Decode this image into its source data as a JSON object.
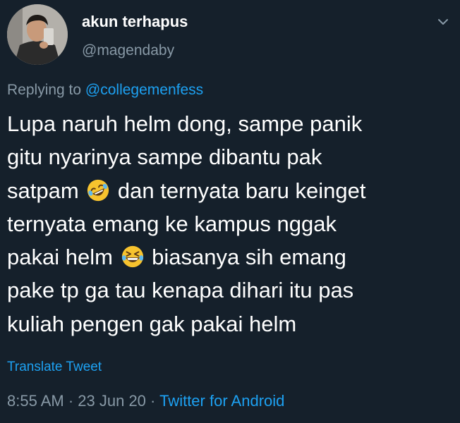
{
  "author": {
    "display_name": "akun terhapus",
    "handle": "@magendaby"
  },
  "reply": {
    "prefix": "Replying to ",
    "mention": "@collegemenfess"
  },
  "tweet": {
    "line1": "Lupa naruh helm dong, sampe panik",
    "line2": "gitu nyarinya sampe dibantu pak",
    "line3_a": "satpam",
    "line3_b": "dan ternyata baru keinget",
    "line4": "ternyata emang ke kampus nggak",
    "line5_a": "pakai helm",
    "line5_b": "biasanya sih emang",
    "line6": "pake tp ga tau kenapa dihari itu pas",
    "line7": "kuliah pengen gak pakai helm"
  },
  "translate_label": "Translate Tweet",
  "meta": {
    "time": "8:55 AM",
    "sep1": " · ",
    "date": "23 Jun 20",
    "sep2": " · ",
    "source": "Twitter for Android"
  },
  "icons": {
    "more": "chevron-down-icon",
    "emoji_1": "rolling-on-floor-laughing-emoji",
    "emoji_2": "grinning-squinting-face-emoji"
  },
  "colors": {
    "background": "#15202b",
    "secondary_text": "#8899a6",
    "link": "#1da1f2"
  }
}
